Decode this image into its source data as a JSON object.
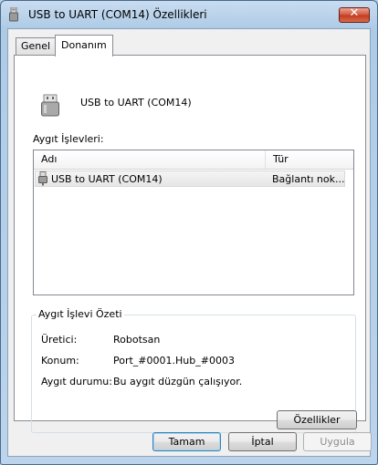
{
  "window": {
    "title": "USB to UART (COM14) Özellikleri"
  },
  "tabs": [
    {
      "label": "Genel"
    },
    {
      "label": "Donanım"
    }
  ],
  "device": {
    "name": "USB to UART (COM14)"
  },
  "functions_list": {
    "label": "Aygıt İşlevleri:",
    "columns": {
      "name": "Adı",
      "type": "Tür"
    },
    "rows": [
      {
        "name": "USB to UART (COM14)",
        "type": "Bağlantı nok..."
      }
    ]
  },
  "summary": {
    "title": "Aygıt İşlevi Özeti",
    "manufacturer_label": "Üretici:",
    "manufacturer_value": "Robotsan",
    "location_label": "Konum:",
    "location_value": "Port_#0001.Hub_#0003",
    "status_label": "Aygıt durumu:",
    "status_value": "Bu aygıt düzgün çalışıyor.",
    "properties_button": "Özellikler"
  },
  "buttons": {
    "ok": "Tamam",
    "cancel": "İptal",
    "apply": "Uygula"
  },
  "colors": {
    "close_button": "#c33a1e",
    "row_highlight": "#e6e6e6",
    "title_bar": "#aecbe6"
  }
}
